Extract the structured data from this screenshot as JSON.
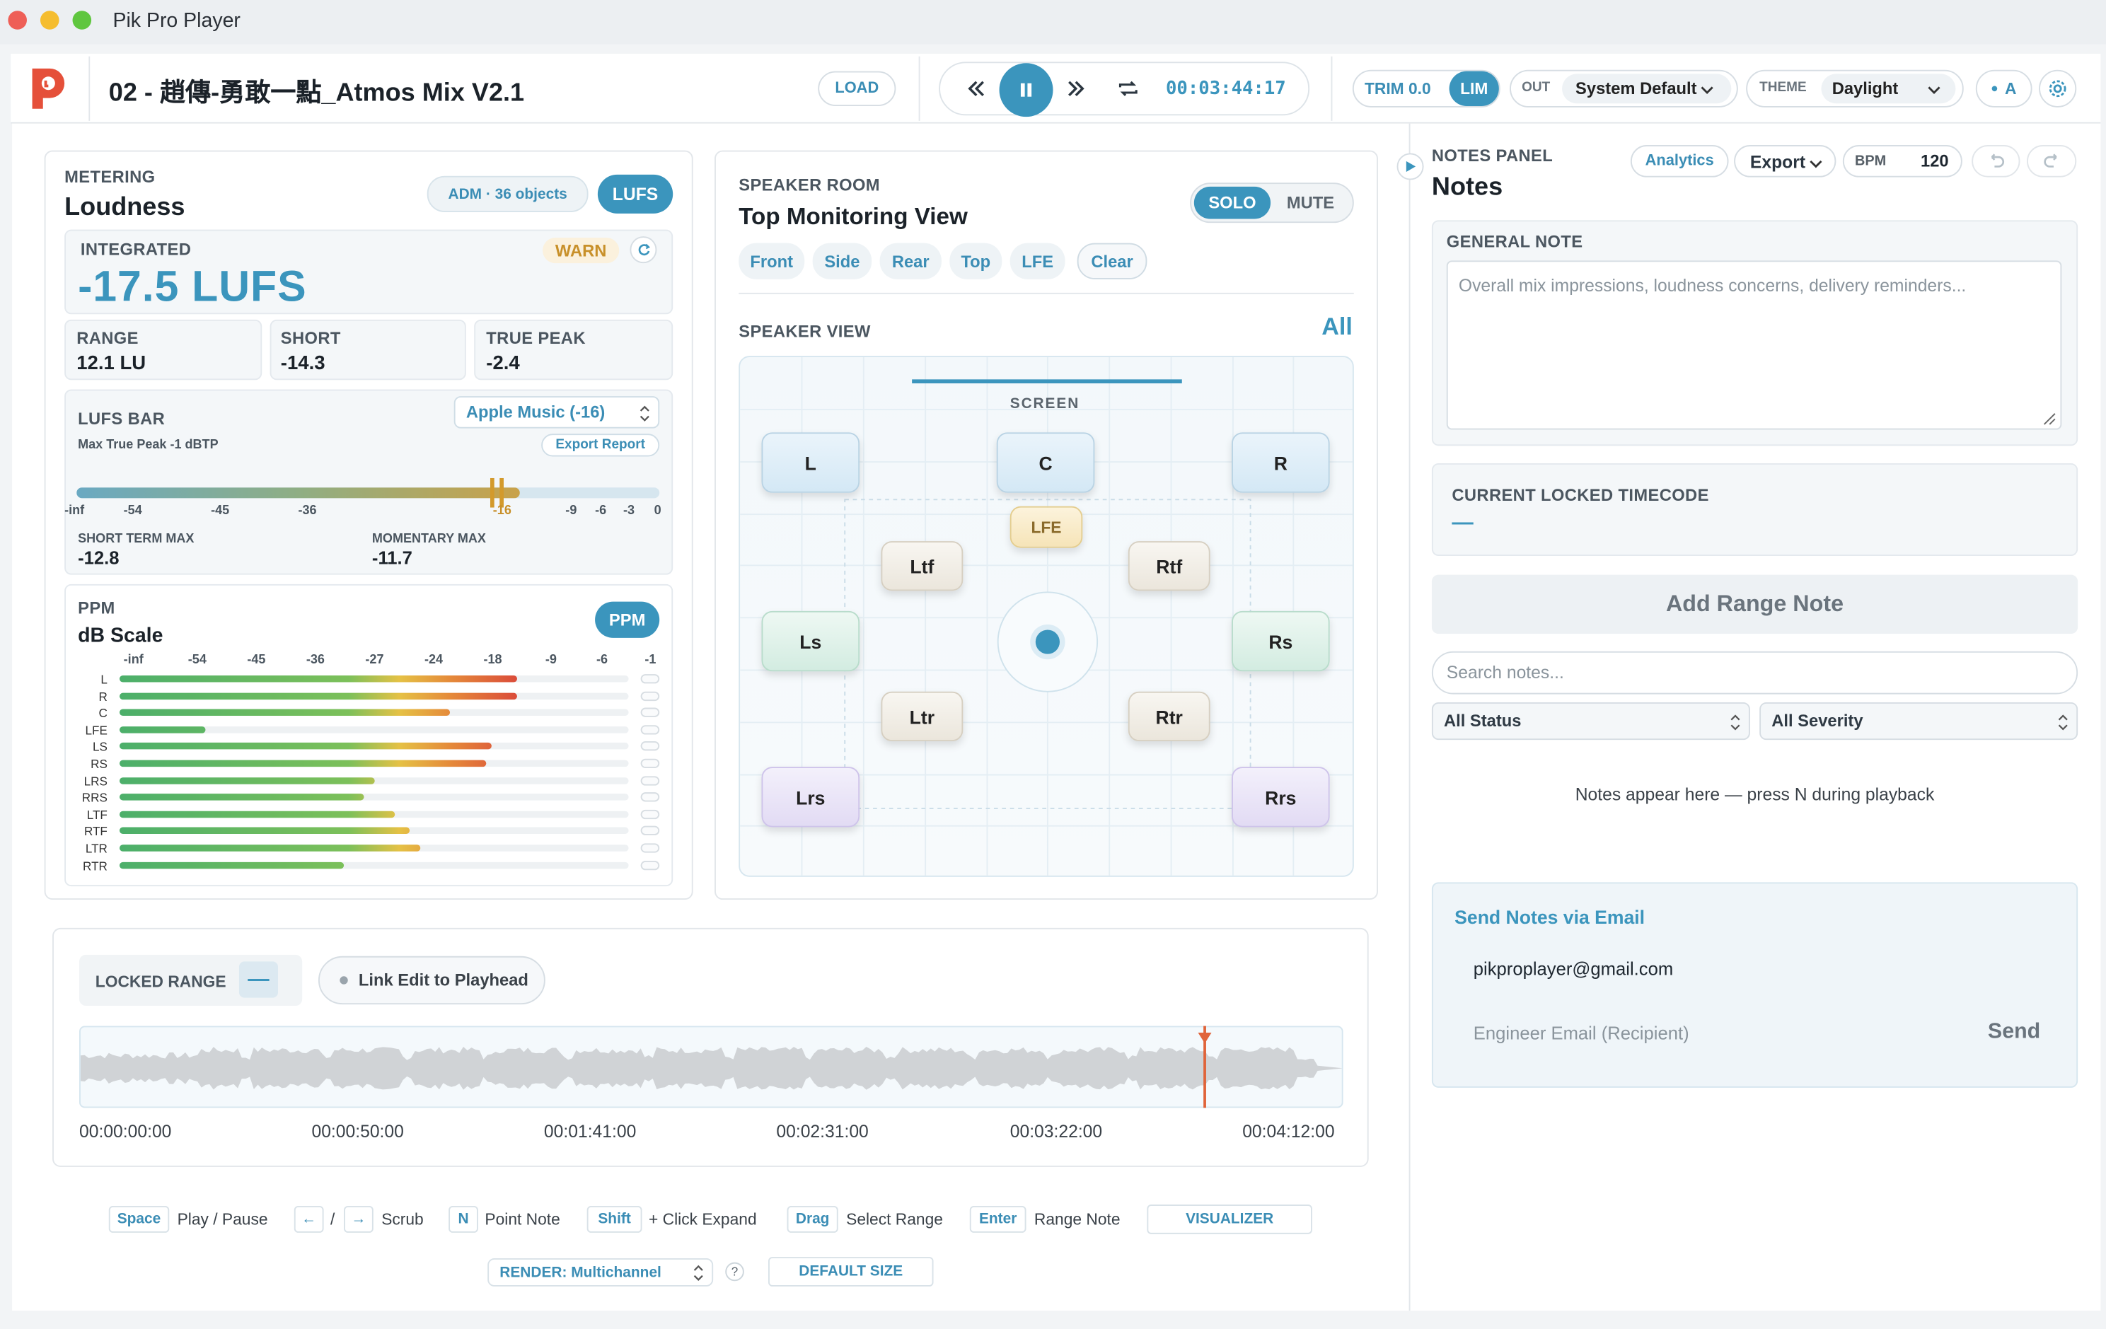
{
  "window": {
    "title": "Pik Pro Player"
  },
  "header": {
    "track_title": "02 - 趙傳-勇敢一點_Atmos Mix V2.1",
    "load_label": "LOAD",
    "timecode": "00:03:44:17",
    "trim_label": "TRIM 0.0",
    "lim_label": "LIM",
    "out_label": "OUT",
    "out_value": "System Default",
    "theme_label": "THEME",
    "theme_value": "Daylight",
    "a_label": "A"
  },
  "metering": {
    "section": "METERING",
    "title": "Loudness",
    "adm_badge": "ADM · 36 objects",
    "lufs_button": "LUFS",
    "integrated_label": "INTEGRATED",
    "warn_label": "WARN",
    "integrated_value": "-17.5 LUFS",
    "stats": [
      {
        "label": "RANGE",
        "value": "12.1 LU"
      },
      {
        "label": "SHORT",
        "value": "-14.3"
      },
      {
        "label": "TRUE PEAK",
        "value": "-2.4"
      }
    ],
    "lufs_bar_label": "LUFS BAR",
    "lufs_preset": "Apple Music (-16)",
    "max_true_peak": "Max True Peak -1 dBTP",
    "export_report": "Export Report",
    "bar_fill_fraction": 0.76,
    "scale": [
      "-inf",
      "-54",
      "-45",
      "-36",
      "-16",
      "-9",
      "-6",
      "-3",
      "0"
    ],
    "short_term_max_label": "SHORT TERM MAX",
    "short_term_max_value": "-12.8",
    "momentary_max_label": "MOMENTARY MAX",
    "momentary_max_value": "-11.7"
  },
  "ppm": {
    "label": "PPM",
    "title": "dB Scale",
    "button": "PPM",
    "scale": [
      "-inf",
      "-54",
      "-45",
      "-36",
      "-27",
      "-24",
      "-18",
      "-9",
      "-6",
      "-1"
    ],
    "channels": [
      {
        "name": "L",
        "level": 0.78
      },
      {
        "name": "R",
        "level": 0.78
      },
      {
        "name": "C",
        "level": 0.65
      },
      {
        "name": "LFE",
        "level": 0.17
      },
      {
        "name": "LS",
        "level": 0.73
      },
      {
        "name": "RS",
        "level": 0.72
      },
      {
        "name": "LRS",
        "level": 0.5
      },
      {
        "name": "RRS",
        "level": 0.48
      },
      {
        "name": "LTF",
        "level": 0.54
      },
      {
        "name": "RTF",
        "level": 0.57
      },
      {
        "name": "LTR",
        "level": 0.59
      },
      {
        "name": "RTR",
        "level": 0.44
      }
    ]
  },
  "speaker_room": {
    "section": "SPEAKER ROOM",
    "title": "Top Monitoring View",
    "solo": "SOLO",
    "mute": "MUTE",
    "filters": [
      "Front",
      "Side",
      "Rear",
      "Top",
      "LFE",
      "Clear"
    ],
    "view_label": "SPEAKER VIEW",
    "view_all": "All",
    "screen": "SCREEN",
    "speakers": {
      "L": "L",
      "C": "C",
      "R": "R",
      "LFE": "LFE",
      "Ltf": "Ltf",
      "Rtf": "Rtf",
      "Ls": "Ls",
      "Rs": "Rs",
      "Ltr": "Ltr",
      "Rtr": "Rtr",
      "Lrs": "Lrs",
      "Rrs": "Rrs"
    }
  },
  "timeline": {
    "locked_range": "LOCKED RANGE",
    "locked_dash": "—",
    "link_edit": "Link Edit to Playhead",
    "playhead_fraction": 0.89,
    "ticks": [
      "00:00:00:00",
      "00:00:50:00",
      "00:01:41:00",
      "00:02:31:00",
      "00:03:22:00",
      "00:04:12:00"
    ]
  },
  "shortcuts": [
    {
      "keys": [
        "Space"
      ],
      "text": "Play / Pause"
    },
    {
      "keys": [
        "←",
        "→"
      ],
      "sep": "/",
      "text": "Scrub"
    },
    {
      "keys": [
        "N"
      ],
      "text": "Point Note"
    },
    {
      "keys": [
        "Shift"
      ],
      "text": "+ Click Expand"
    },
    {
      "keys": [
        "Drag"
      ],
      "text": "Select Range"
    },
    {
      "keys": [
        "Enter"
      ],
      "text": "Range Note"
    }
  ],
  "footer": {
    "visualizer": "VISUALIZER",
    "render": "RENDER: Multichannel",
    "help": "?",
    "default_size": "DEFAULT SIZE"
  },
  "notes": {
    "section": "NOTES PANEL",
    "title": "Notes",
    "analytics": "Analytics",
    "export": "Export",
    "bpm_label": "BPM",
    "bpm_value": "120",
    "general_note_label": "GENERAL NOTE",
    "general_note_placeholder": "Overall mix impressions, loudness concerns, delivery reminders...",
    "locked_tc_label": "CURRENT LOCKED TIMECODE",
    "locked_tc_value": "—",
    "add_range_note": "Add Range Note",
    "search_placeholder": "Search notes...",
    "status_filter": "All Status",
    "severity_filter": "All Severity",
    "empty_text": "Notes appear here — press N during playback",
    "email_title": "Send Notes via Email",
    "email_from": "pikproplayer@gmail.com",
    "email_to_placeholder": "Engineer Email (Recipient)",
    "send": "Send"
  },
  "colors": {
    "accent": "#3b95bd",
    "warn": "#c8902a",
    "playhead": "#e0643a"
  }
}
